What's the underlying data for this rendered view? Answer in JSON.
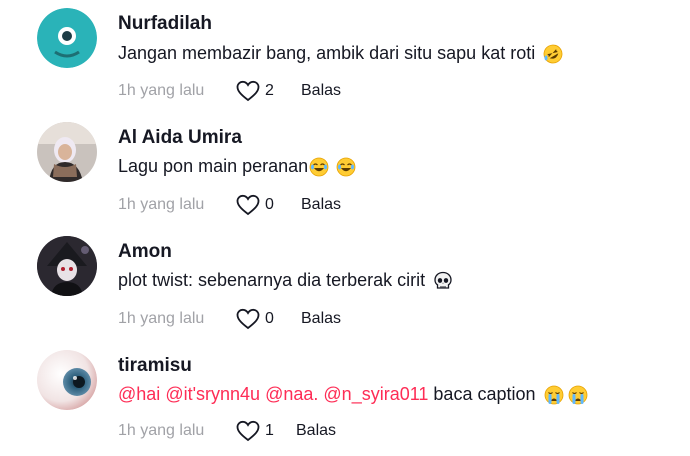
{
  "comments": [
    {
      "username": "Nurfadilah",
      "text": "Jangan membazir bang, ambik dari situ sapu kat roti",
      "emoji": [
        "rofl-emoji"
      ],
      "time": "1h yang lalu",
      "likes": "2",
      "reply_label": "Balas"
    },
    {
      "username": "Al Aida Umira",
      "text": "Lagu pon main peranan",
      "emoji": [
        "joy-emoji",
        "joy-emoji"
      ],
      "time": "1h yang lalu",
      "likes": "0",
      "reply_label": "Balas"
    },
    {
      "username": "Amon",
      "text": "plot twist: sebenarnya dia terberak cirit",
      "emoji": [
        "skull-emoji"
      ],
      "time": "1h yang lalu",
      "likes": "0",
      "reply_label": "Balas"
    },
    {
      "username": "tiramisu",
      "mentions": [
        "@hai",
        "@it'srynn4u",
        "@naa.",
        "@n_syira011"
      ],
      "text": "baca caption",
      "emoji": [
        "sob-emoji",
        "sob-emoji"
      ],
      "time": "1h yang lalu",
      "likes": "1",
      "reply_label": "Balas"
    }
  ],
  "colors": {
    "mention": "#fe2c55",
    "meta_gray": "#a1a2a7",
    "text": "#161823"
  }
}
